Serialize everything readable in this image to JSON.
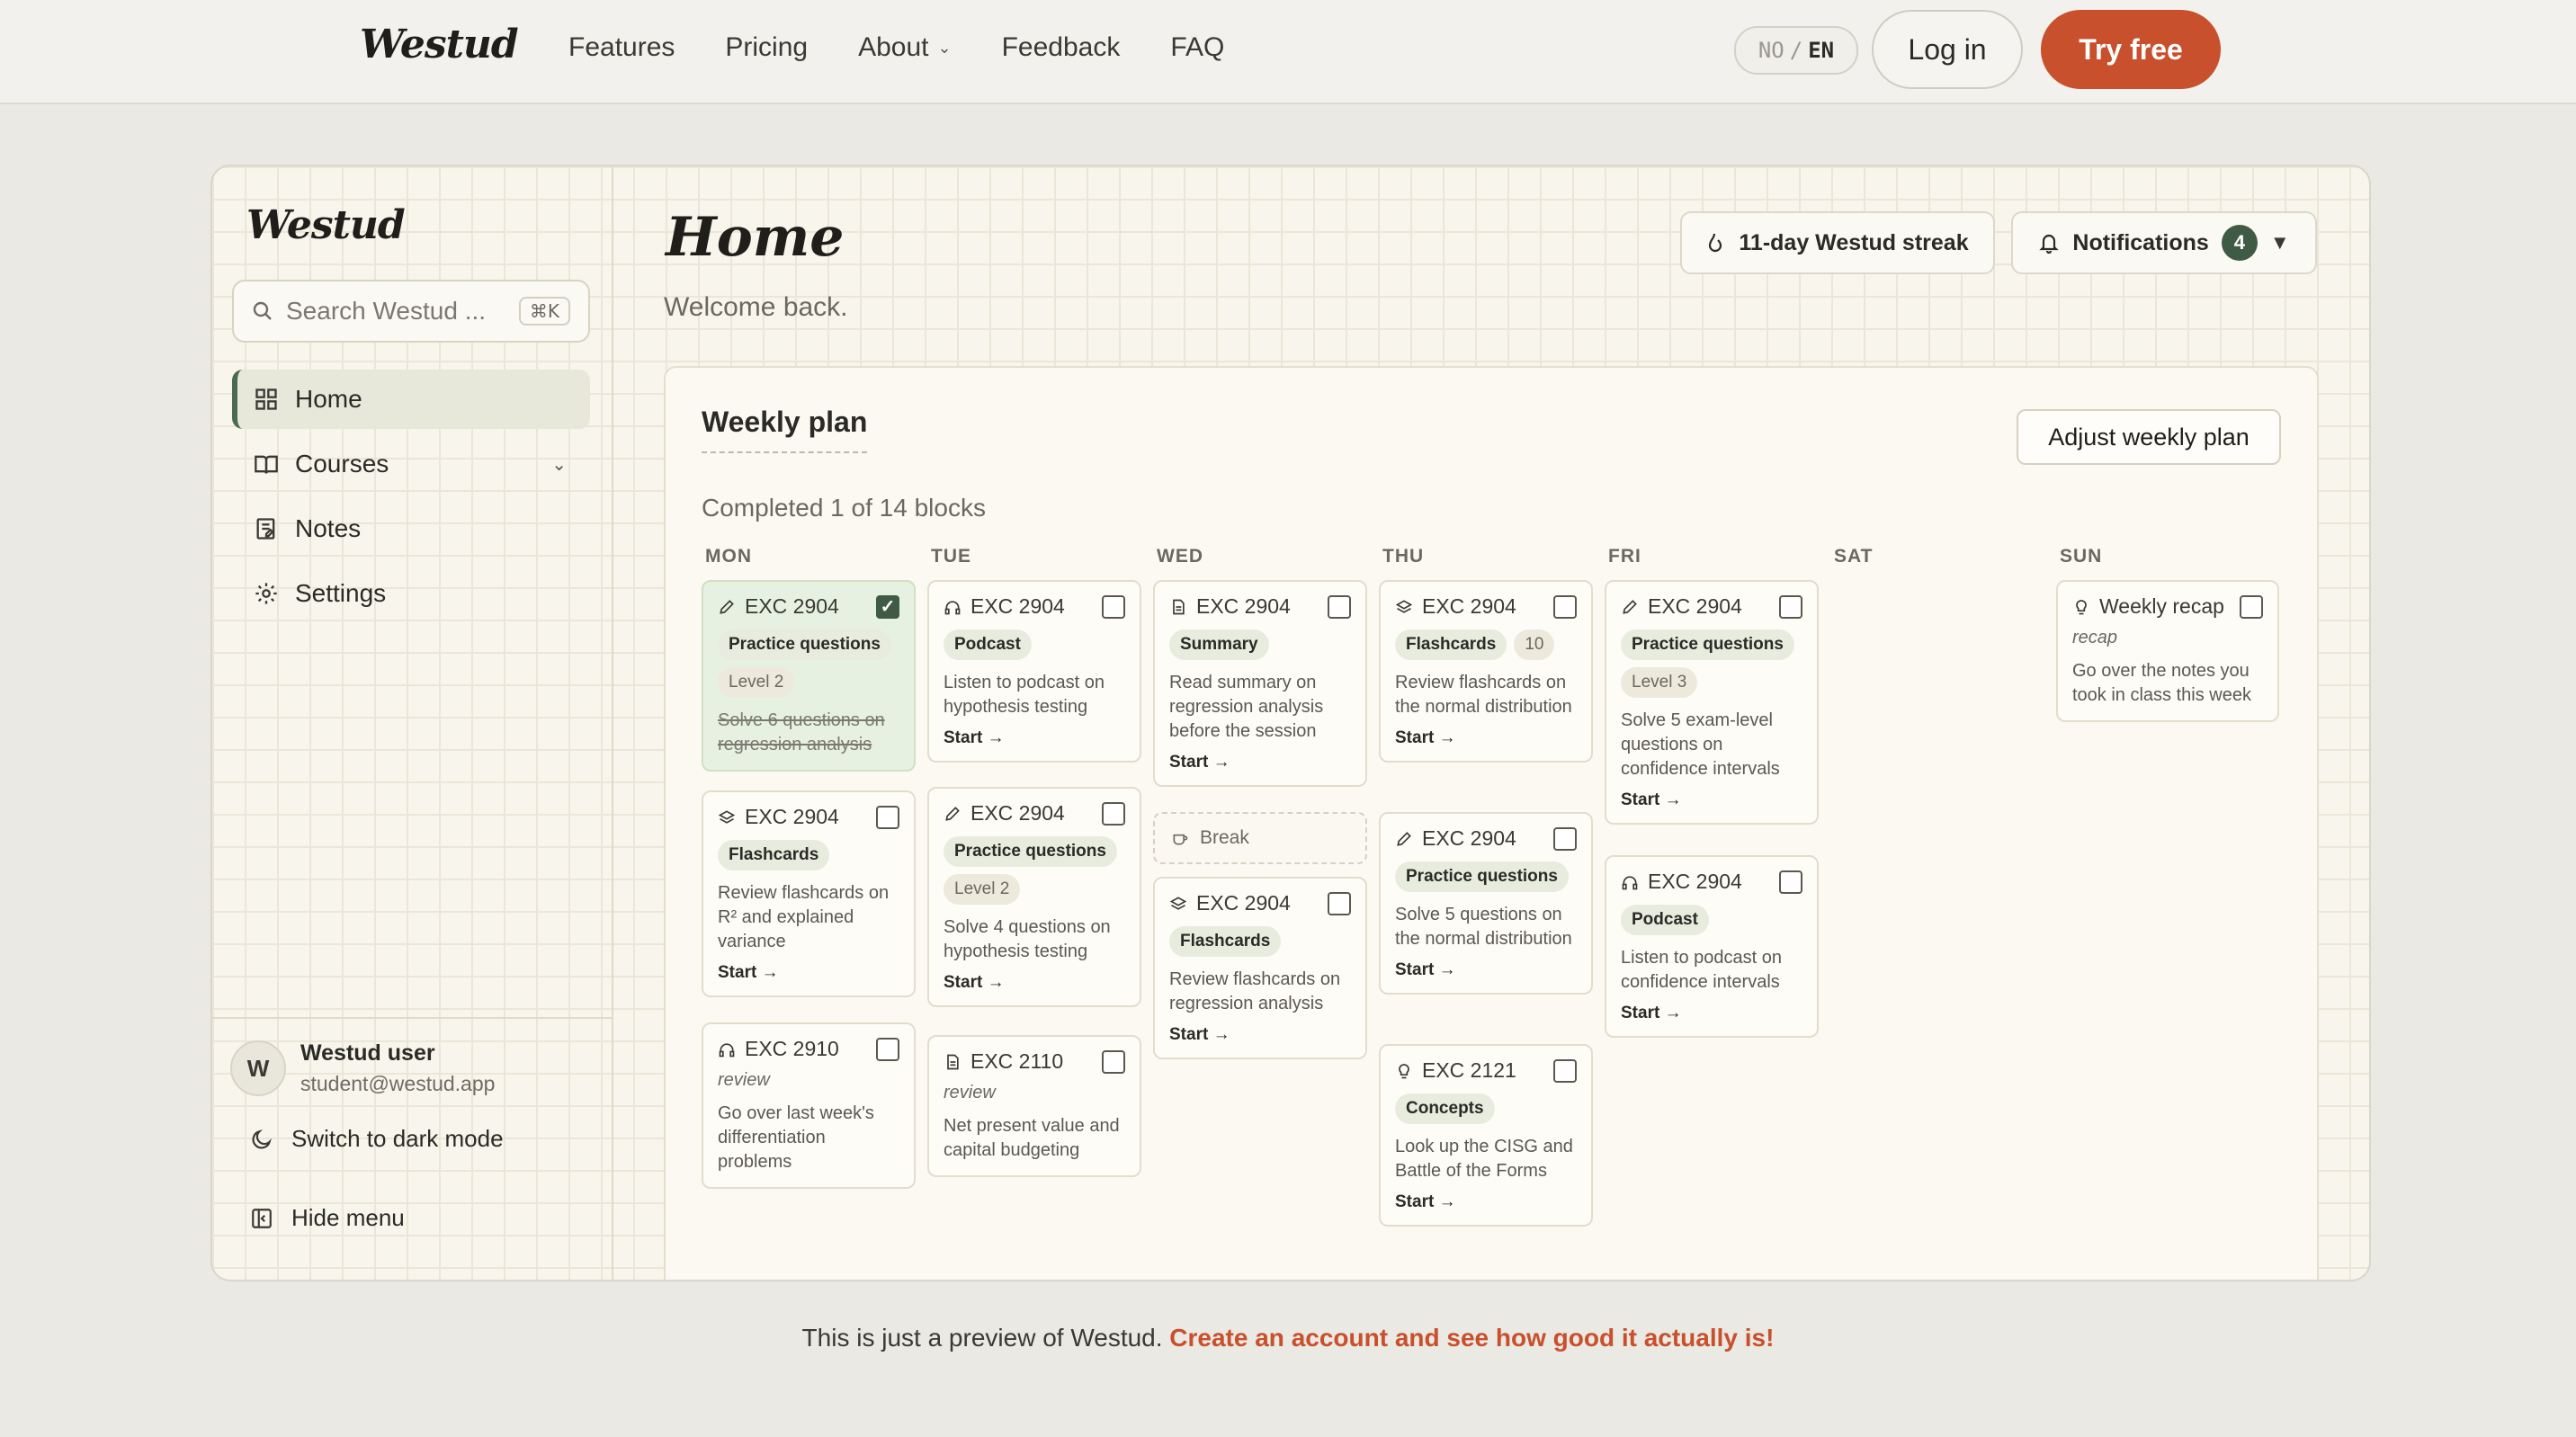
{
  "site": {
    "brand": "Westud",
    "nav": [
      "Features",
      "Pricing",
      "About",
      "Feedback",
      "FAQ"
    ],
    "lang_no": "NO",
    "lang_sep": "/",
    "lang_en": "EN",
    "login": "Log in",
    "try_free": "Try free"
  },
  "app": {
    "brand": "Westud",
    "search_placeholder": "Search Westud ...",
    "search_shortcut": "⌘K",
    "nav": [
      {
        "label": "Home",
        "icon": "grid-icon",
        "active": true
      },
      {
        "label": "Courses",
        "icon": "book-icon"
      },
      {
        "label": "Notes",
        "icon": "notes-icon"
      },
      {
        "label": "Settings",
        "icon": "gear-icon"
      }
    ],
    "user": {
      "initial": "W",
      "name": "Westud user",
      "email": "student@westud.app"
    },
    "dark_mode": "Switch to dark mode",
    "hide_menu": "Hide menu"
  },
  "header": {
    "title": "Home",
    "subtitle": "Welcome back.",
    "streak": "11-day Westud streak",
    "notifications": "Notifications",
    "notif_count": "4"
  },
  "weekly": {
    "title": "Weekly plan",
    "adjust": "Adjust weekly plan",
    "progress": "Completed 1 of 14 blocks",
    "days": [
      "MON",
      "TUE",
      "WED",
      "THU",
      "FRI",
      "SAT",
      "SUN"
    ],
    "cards": {
      "mon1": {
        "code": "EXC 2904",
        "tag": "Practice questions",
        "level": "Level 2",
        "desc": "Solve 6 questions on regression analysis"
      },
      "mon2": {
        "code": "EXC 2904",
        "tag": "Flashcards",
        "desc": "Review flashcards on R² and explained variance",
        "start": "Start →"
      },
      "mon3": {
        "code": "EXC 2910",
        "kind": "review",
        "desc": "Go over last week's differentiation problems"
      },
      "tue1": {
        "code": "EXC 2904",
        "tag": "Podcast",
        "desc": "Listen to podcast on hypothesis testing",
        "start": "Start →"
      },
      "tue2": {
        "code": "EXC 2904",
        "tag": "Practice questions",
        "level": "Level 2",
        "desc": "Solve 4 questions on hypothesis testing",
        "start": "Start →"
      },
      "tue3": {
        "code": "EXC 2110",
        "kind": "review",
        "desc": "Net present value and capital budgeting"
      },
      "wed1": {
        "code": "EXC 2904",
        "tag": "Summary",
        "desc": "Read summary on regression analysis before the session",
        "start": "Start →"
      },
      "wed_break": "Break",
      "wed2": {
        "code": "EXC 2904",
        "tag": "Flashcards",
        "desc": "Review flashcards on regression analysis",
        "start": "Start →"
      },
      "thu1": {
        "code": "EXC 2904",
        "tag": "Flashcards",
        "count": "10",
        "desc": "Review flashcards on the normal distribution",
        "start": "Start →"
      },
      "thu2": {
        "code": "EXC 2904",
        "tag": "Practice questions",
        "desc": "Solve 5 questions on the normal distribution",
        "start": "Start →"
      },
      "thu3": {
        "code": "EXC 2121",
        "tag": "Concepts",
        "desc": "Look up the CISG and Battle of the Forms",
        "start": "Start →"
      },
      "fri1": {
        "code": "EXC 2904",
        "tag": "Practice questions",
        "level": "Level 3",
        "desc": "Solve 5 exam-level questions on confidence intervals",
        "start": "Start →"
      },
      "fri2": {
        "code": "EXC 2904",
        "tag": "Podcast",
        "desc": "Listen to podcast on confidence intervals",
        "start": "Start →"
      },
      "sun1": {
        "code": "Weekly recap",
        "kind": "recap",
        "desc": "Go over the notes you took in class this week"
      }
    }
  },
  "footer": {
    "text": "This is just a preview of Westud.",
    "cta": "Create an account and see how good it actually is!"
  },
  "colors": {
    "accent": "#c8502c",
    "green": "#3f5b45",
    "background": "#ebe9e3"
  }
}
